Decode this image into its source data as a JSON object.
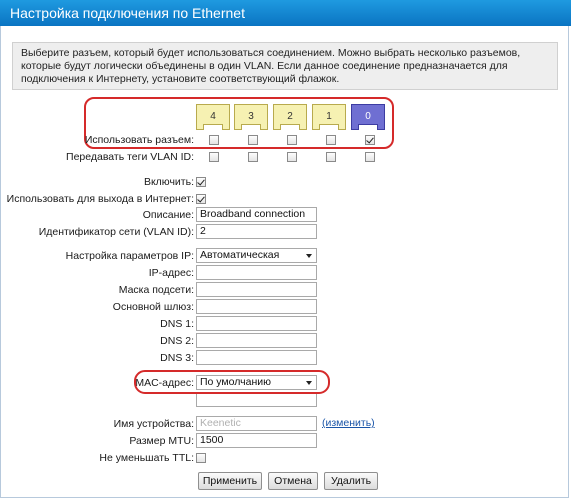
{
  "window": {
    "title": "Настройка подключения по Ethernet"
  },
  "info_text": "Выберите разъем, который будет использоваться соединением. Можно выбрать несколько разъемов, которые будут логически объединены в один VLAN. Если данное соединение предназначается для подключения к Интернету, установите соответствующий флажок.",
  "ports": {
    "labels": [
      "4",
      "3",
      "2",
      "1",
      "0"
    ],
    "use_port_label": "Использовать разъем:",
    "use_port_checked": [
      false,
      false,
      false,
      false,
      true
    ],
    "vlan_tags_label": "Передавать теги VLAN ID:",
    "vlan_tags_checked": [
      false,
      false,
      false,
      false,
      false
    ]
  },
  "form": {
    "enable_label": "Включить:",
    "enable_checked": true,
    "internet_label": "Использовать для выхода в Интернет:",
    "internet_checked": true,
    "description_label": "Описание:",
    "description_value": "Broadband connection",
    "vlan_id_label": "Идентификатор сети (VLAN ID):",
    "vlan_id_value": "2",
    "ip_settings_label": "Настройка параметров IP:",
    "ip_settings_value": "Автоматическая",
    "ip_address_label": "IP-адрес:",
    "ip_address_value": "",
    "subnet_label": "Маска подсети:",
    "subnet_value": "",
    "gateway_label": "Основной шлюз:",
    "gateway_value": "",
    "dns1_label": "DNS 1:",
    "dns1_value": "",
    "dns2_label": "DNS 2:",
    "dns2_value": "",
    "dns3_label": "DNS 3:",
    "dns3_value": "",
    "mac_label": "MAC-адрес:",
    "mac_value": "По умолчанию",
    "mac_extra_value": "",
    "device_name_label": "Имя устройства:",
    "device_name_value": "Keenetic",
    "change_link": "(изменить)",
    "mtu_label": "Размер MTU:",
    "mtu_value": "1500",
    "ttl_label": "Не уменьшать TTL:",
    "ttl_checked": false
  },
  "buttons": {
    "apply": "Применить",
    "cancel": "Отмена",
    "delete": "Удалить"
  },
  "colors": {
    "title_bar": "#0a74c2",
    "highlight": "#d52a2a",
    "port_inactive": "#f6f1b2",
    "port_active": "#6f6fd2"
  }
}
